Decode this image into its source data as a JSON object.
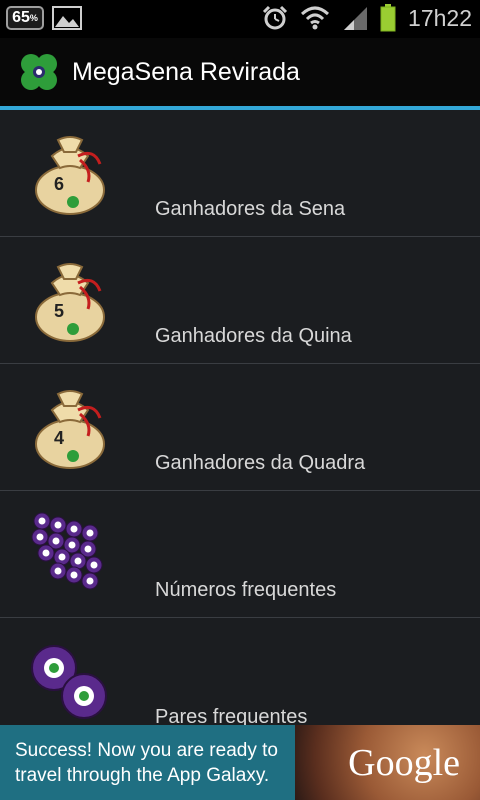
{
  "status_bar": {
    "battery_badge": "65",
    "battery_badge_unit": "%",
    "time": "17h22"
  },
  "action_bar": {
    "title": "MegaSena Revirada",
    "accent_color": "#33a8d8"
  },
  "list": {
    "items": [
      {
        "label": "Ganhadores da Sena",
        "icon": "money-bag-6-icon",
        "bag_number": "6"
      },
      {
        "label": "Ganhadores da Quina",
        "icon": "money-bag-5-icon",
        "bag_number": "5"
      },
      {
        "label": "Ganhadores da Quadra",
        "icon": "money-bag-4-icon",
        "bag_number": "4"
      },
      {
        "label": "Números frequentes",
        "icon": "lottery-balls-icon"
      },
      {
        "label": "Pares frequentes",
        "icon": "two-balls-icon"
      }
    ]
  },
  "ad": {
    "message": "Success! Now you are ready to travel through the App Galaxy.",
    "brand": "Google"
  }
}
